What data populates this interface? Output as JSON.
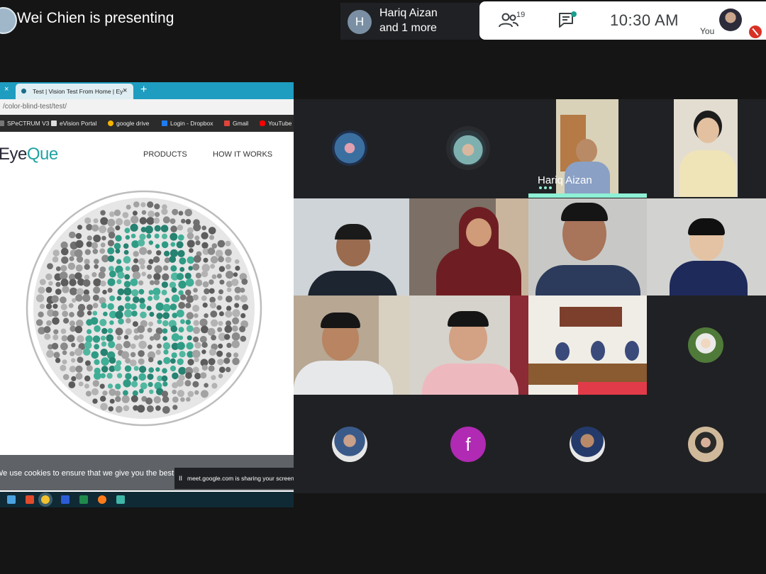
{
  "meeting": {
    "presenter_title": "Wei Chien is presenting",
    "speaker_initial": "H",
    "speaker_line1": "Hariq Aizan",
    "speaker_line2": "and 1 more",
    "participant_count": "19",
    "clock": "10:30 AM",
    "you_label": "You",
    "active_speaker_name": "Hariq Aizan",
    "tile_letter": "f",
    "colors": {
      "active": "#8ef0d5",
      "tile_bg": "#3c4043",
      "grid_bg": "#202124",
      "mic_off": "#d93025",
      "letter_avatar": "#b02ab3"
    }
  },
  "browser": {
    "tab_title": "Test | Vision Test From Home | Ey",
    "new_tab": "+",
    "close": "×",
    "url": "/color-blind-test/test/",
    "bookmarks": [
      "SPeCTRUM V3",
      "eVision Portal",
      "google drive",
      "Login - Dropbox",
      "Gmail",
      "YouTube"
    ],
    "logo_part1": "Eye",
    "logo_part2": "Que",
    "nav": [
      "PRODUCTS",
      "HOW IT WORKS"
    ],
    "cookie_text": "We use cookies to ensure that we give you the best ex",
    "share_message": "meet.google.com is sharing your screen.",
    "share_pause": "II",
    "colors": {
      "tabbar": "#1e9dc0",
      "plate_teal": "#2f9a84",
      "plate_gray": "#8a8a8a"
    }
  }
}
